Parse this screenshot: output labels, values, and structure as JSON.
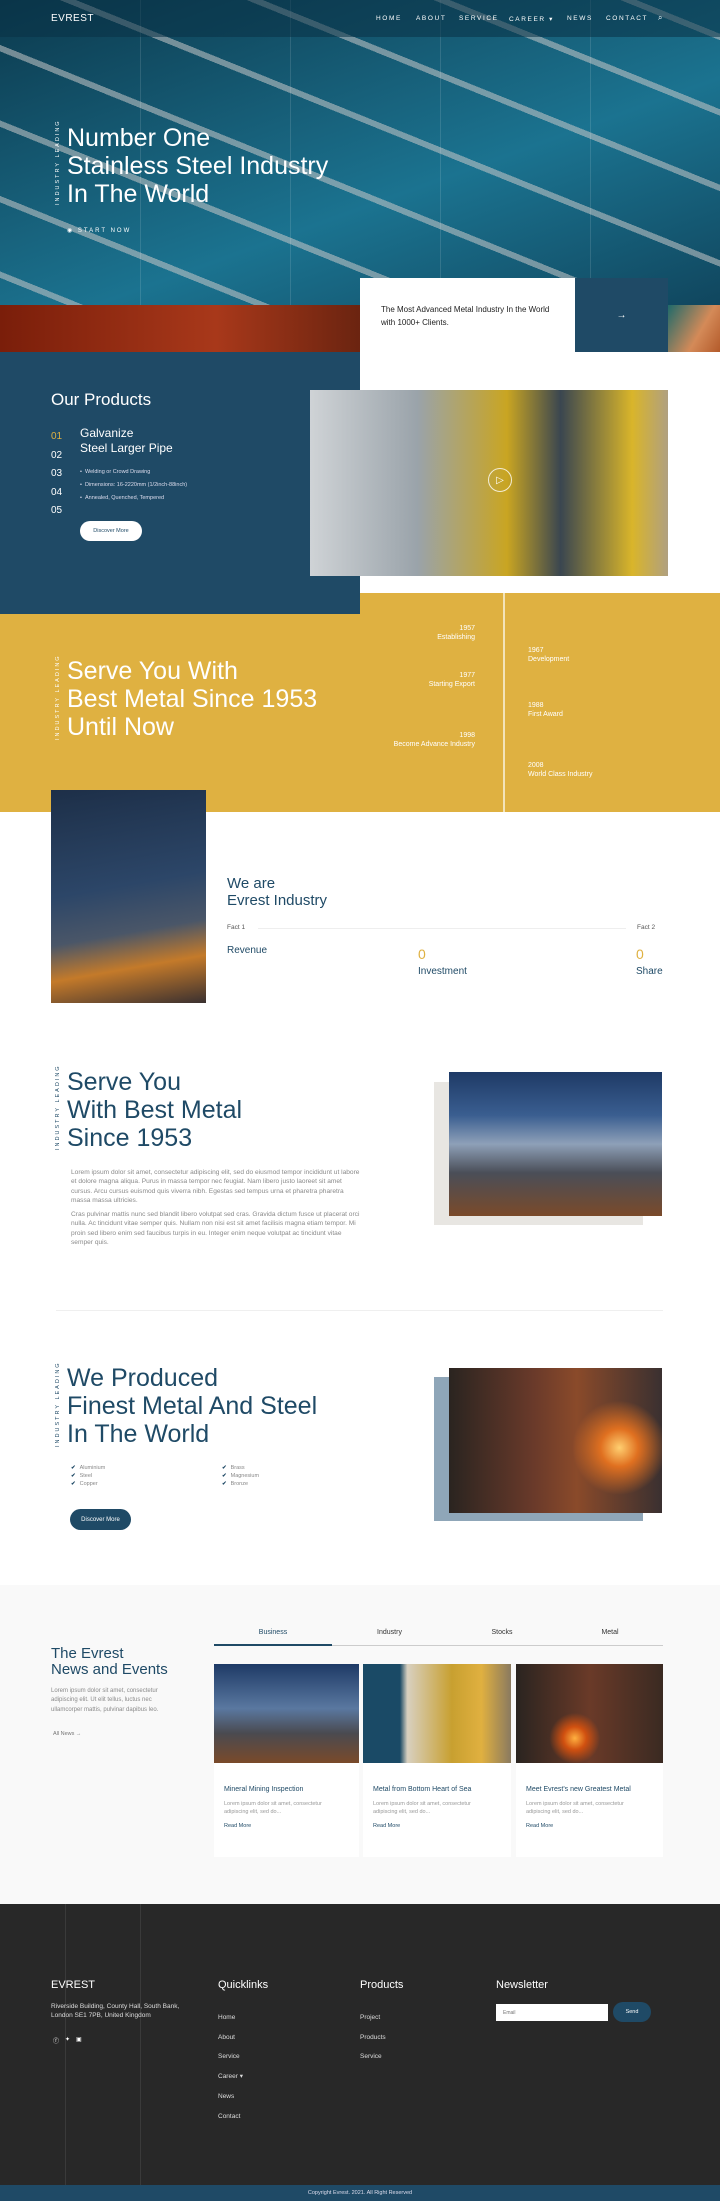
{
  "brand": "EVREST",
  "nav": {
    "items": [
      "HOME",
      "ABOUT",
      "SERVICE",
      "CAREER",
      "NEWS",
      "CONTACT"
    ],
    "search_icon": "search-icon"
  },
  "hero": {
    "eyebrow": "INDUSTRY LEADING",
    "title_lines": [
      "Number One",
      "Stainless Steel Industry",
      "In The World"
    ],
    "cta": "START NOW",
    "card_text": "The Most Advanced Metal Industry In the World with 1000+ Clients.",
    "arrow": "→"
  },
  "products": {
    "title": "Our Products",
    "numbers": [
      "01",
      "02",
      "03",
      "04",
      "05"
    ],
    "active_index": 0,
    "name_lines": [
      "Galvanize",
      "Steel Larger Pipe"
    ],
    "bullets": [
      "Welding or Crowd Drawing",
      "Dimensions: 16-2220mm (1/2inch-88inch)",
      "Annealed, Quenched, Tempered"
    ],
    "button": "Discover More"
  },
  "history": {
    "eyebrow": "INDUSTRY LEADING",
    "title_lines": [
      "Serve You With",
      "Best Metal Since 1953",
      "Until Now"
    ],
    "left": [
      {
        "year": "1957",
        "label": "Establishing"
      },
      {
        "year": "1977",
        "label": "Starting Export"
      },
      {
        "year": "1998",
        "label": "Become Advance Industry"
      }
    ],
    "right": [
      {
        "year": "1967",
        "label": "Development"
      },
      {
        "year": "1988",
        "label": "First Award"
      },
      {
        "year": "2008",
        "label": "World Class Industry"
      }
    ]
  },
  "about": {
    "title_lines": [
      "We are",
      "Evrest Industry"
    ],
    "fact1": "Fact 1",
    "fact2": "Fact 2",
    "revenue": "Revenue",
    "investment_value": "0",
    "investment": "Investment",
    "share_value": "0",
    "share": "Share"
  },
  "serve": {
    "eyebrow": "INDUSTRY LEADING",
    "title_lines": [
      "Serve You",
      "With Best Metal",
      "Since 1953"
    ],
    "p1": "Lorem ipsum dolor sit amet, consectetur adipiscing elit, sed do eiusmod tempor incididunt ut labore et dolore magna aliqua. Purus in massa tempor nec feugiat. Nam libero justo laoreet sit amet cursus. Arcu cursus euismod quis viverra nibh. Egestas sed tempus urna et pharetra pharetra massa massa ultricies.",
    "p2": "Cras pulvinar mattis nunc sed blandit libero volutpat sed cras. Gravida dictum fusce ut placerat orci nulla. Ac tincidunt vitae semper quis. Nullam non nisi est sit amet facilisis magna etiam tempor. Mi proin sed libero enim sed faucibus turpis in eu. Integer enim neque volutpat ac tincidunt vitae semper quis."
  },
  "produced": {
    "eyebrow": "INDUSTRY LEADING",
    "title_lines": [
      "We Produced",
      "Finest Metal And Steel",
      "In The World"
    ],
    "col1": [
      "Aluminium",
      "Steel",
      "Copper"
    ],
    "col2": [
      "Brass",
      "Magnesium",
      "Bronze"
    ],
    "button": "Discover More"
  },
  "news": {
    "title_lines": [
      "The Evrest",
      "News and Events"
    ],
    "text": "Lorem ipsum dolor sit amet, consectetur adipiscing elit. Ut elit tellus, luctus nec ullamcorper mattis, pulvinar dapibus leo.",
    "all_news": "All News →",
    "tabs": [
      "Business",
      "Industry",
      "Stocks",
      "Metal"
    ],
    "active_tab": 0,
    "cards": [
      {
        "title": "Mineral Mining Inspection",
        "text": "Lorem ipsum dolor sit amet, consectetur adipiscing elit, sed do...",
        "link": "Read More"
      },
      {
        "title": "Metal from Bottom Heart of Sea",
        "text": "Lorem ipsum dolor sit amet, consectetur adipiscing elit, sed do...",
        "link": "Read More"
      },
      {
        "title": "Meet Evrest's new Greatest Metal",
        "text": "Lorem ipsum dolor sit amet, consectetur adipiscing elit, sed do...",
        "link": "Read More"
      }
    ]
  },
  "footer": {
    "brand": "EVREST",
    "address": "Riverside Building, County Hall, South Bank, London SE1 7PB, United Kingdom",
    "social": [
      "facebook-icon",
      "twitter-icon",
      "youtube-icon"
    ],
    "quicklinks_title": "Quicklinks",
    "quicklinks": [
      "Home",
      "About",
      "Service",
      "Career",
      "News",
      "Contact"
    ],
    "products_title": "Products",
    "products": [
      "Project",
      "Products",
      "Service"
    ],
    "newsletter_title": "Newsletter",
    "email_placeholder": "Email",
    "send": "Send",
    "copyright": "Copyright Evrest. 2021. All Right Reserved"
  },
  "colors": {
    "navy": "#1f4a66",
    "gold": "#dfb141",
    "footer": "#282828"
  }
}
